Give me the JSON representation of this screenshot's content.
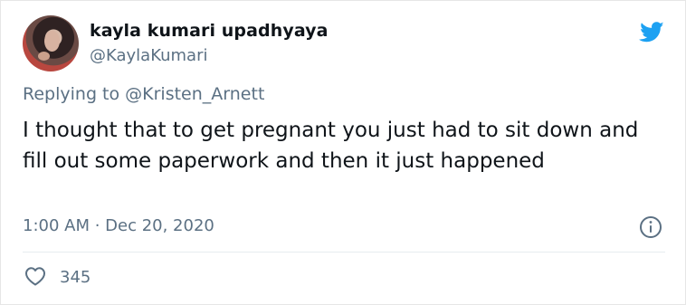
{
  "tweet": {
    "author_name": "kayla kumari upadhyaya",
    "author_handle": "@KaylaKumari",
    "reply_text": "Replying to @Kristen_Arnett",
    "body": "I thought that to get pregnant you just had to sit down and fill out some paperwork and then it just happened",
    "timestamp": "1:00 AM · Dec 20, 2020",
    "like_count": "345",
    "icons": {
      "brand": "twitter-bird-icon",
      "info": "info-icon",
      "like": "heart-icon"
    },
    "colors": {
      "brand": "#1da1f2",
      "text": "#0f1419",
      "secondary": "#5b7083",
      "divider": "#e6ecf0"
    }
  }
}
